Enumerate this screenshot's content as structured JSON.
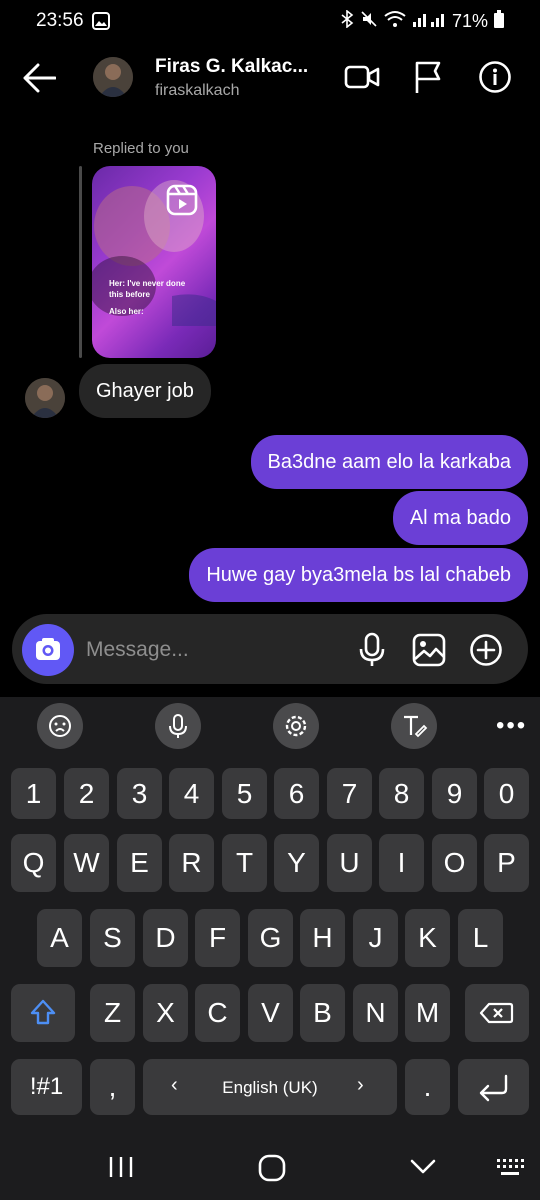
{
  "status": {
    "time": "23:56",
    "battery": "71%"
  },
  "header": {
    "name": "Firas G. Kalkac...",
    "username": "firaskalkach"
  },
  "chat": {
    "replied_label": "Replied to you",
    "reel_caption_1": "Her: I've never done this before",
    "reel_caption_2": "Also her:",
    "incoming": "Ghayer job",
    "outgoing": [
      "Ba3dne aam elo la karkaba",
      "Al ma bado",
      "Huwe gay bya3mela bs lal chabeb"
    ]
  },
  "composer": {
    "placeholder": "Message..."
  },
  "keyboard": {
    "row_numbers": [
      "1",
      "2",
      "3",
      "4",
      "5",
      "6",
      "7",
      "8",
      "9",
      "0"
    ],
    "row1": [
      "Q",
      "W",
      "E",
      "R",
      "T",
      "Y",
      "U",
      "I",
      "O",
      "P"
    ],
    "row2": [
      "A",
      "S",
      "D",
      "F",
      "G",
      "H",
      "J",
      "K",
      "L"
    ],
    "row3": [
      "Z",
      "X",
      "C",
      "V",
      "B",
      "N",
      "M"
    ],
    "symbols": "!#1",
    "comma": ",",
    "language": "English (UK)",
    "period": "."
  }
}
